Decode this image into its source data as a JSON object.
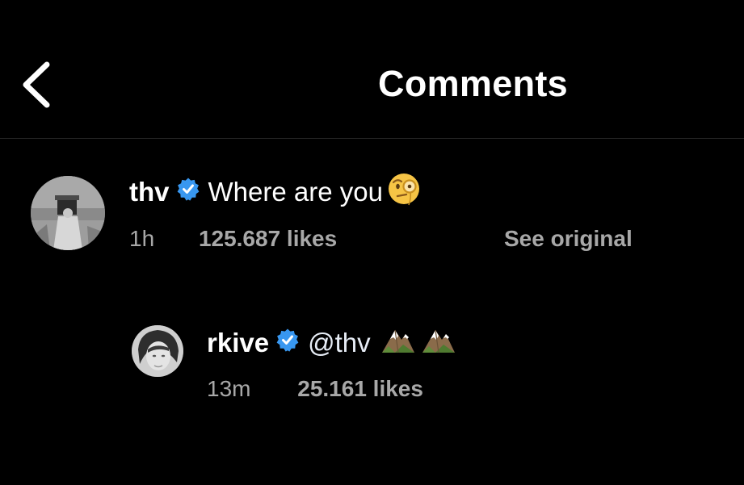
{
  "header": {
    "title": "Comments",
    "back_icon": "chevron-left-icon"
  },
  "comments": [
    {
      "username": "thv",
      "verified": true,
      "text": "Where are you",
      "emoji": "face-with-monocle",
      "time": "1h",
      "likes": "125.687 likes",
      "see_original": "See original"
    }
  ],
  "replies": [
    {
      "username": "rkive",
      "verified": true,
      "mention": "@thv",
      "emoji": [
        "snow-capped-mountain",
        "snow-capped-mountain"
      ],
      "time": "13m",
      "likes": "25.161 likes"
    }
  ],
  "colors": {
    "background": "#000000",
    "text": "#ffffff",
    "secondary_text": "#a8a8a8",
    "verified_badge": "#3897f0",
    "divider": "#262626"
  }
}
